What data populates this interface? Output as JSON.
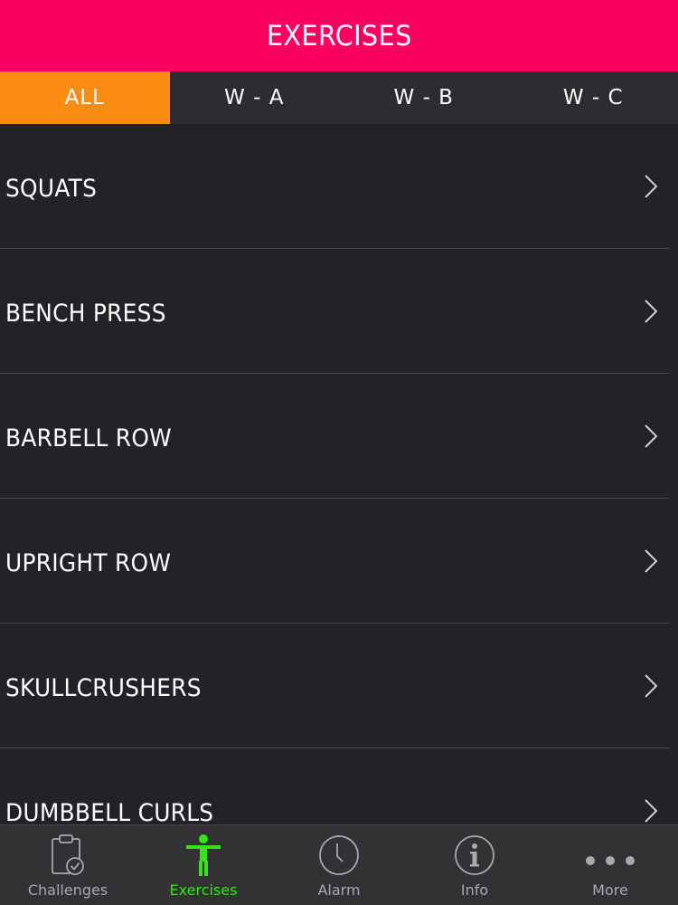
{
  "header": {
    "title": "EXERCISES"
  },
  "tabs": [
    {
      "label": "ALL",
      "active": true
    },
    {
      "label": "W - A",
      "active": false
    },
    {
      "label": "W - B",
      "active": false
    },
    {
      "label": "W - C",
      "active": false
    }
  ],
  "exercises": [
    {
      "label": "SQUATS"
    },
    {
      "label": "BENCH PRESS"
    },
    {
      "label": "BARBELL ROW"
    },
    {
      "label": "UPRIGHT ROW"
    },
    {
      "label": "SKULLCRUSHERS"
    },
    {
      "label": "DUMBBELL CURLS"
    }
  ],
  "tabbar": {
    "items": [
      {
        "label": "Challenges",
        "icon": "clipboard-check-icon"
      },
      {
        "label": "Exercises",
        "icon": "person-icon",
        "active": true
      },
      {
        "label": "Alarm",
        "icon": "clock-icon"
      },
      {
        "label": "Info",
        "icon": "info-icon"
      },
      {
        "label": "More",
        "icon": "more-dots-icon"
      }
    ]
  },
  "colors": {
    "header": "#fb0060",
    "active_tab": "#fb8c13",
    "background": "#232228",
    "tabbar_active": "#35e318"
  }
}
